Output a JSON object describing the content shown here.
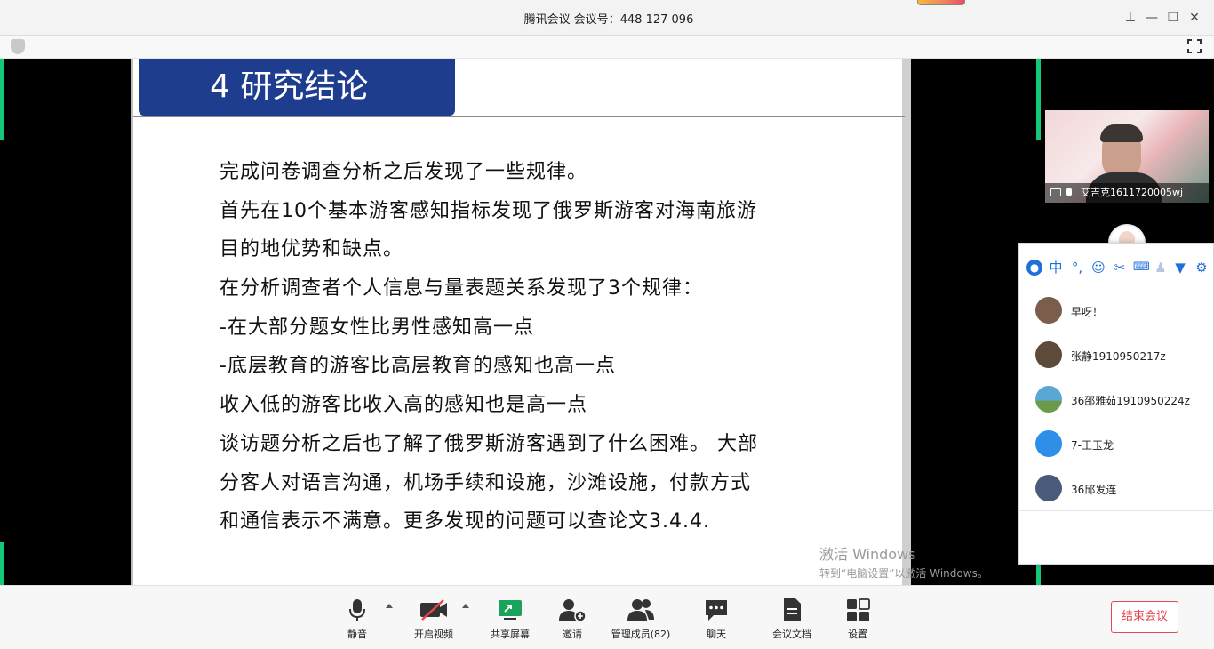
{
  "window": {
    "title_app": "腾讯会议",
    "title_meeting": "会议号：448 127 096"
  },
  "slide": {
    "title": "4  研究结论",
    "lines": [
      "完成问卷调查分析之后发现了一些规律。",
      "首先在10个基本游客感知指标发现了俄罗斯游客对海南旅游",
      "目的地优势和缺点。",
      "在分析调查者个人信息与量表题关系发现了3个规律：",
      "-在大部分题女性比男性感知高一点",
      "-底层教育的游客比高层教育的感知也高一点",
      "收入低的游客比收入高的感知也是高一点",
      "谈访题分析之后也了解了俄罗斯游客遇到了什么困难。 大部",
      "分客人对语言沟通，机场手续和设施，沙滩设施，付款方式",
      "和通信表示不满意。更多发现的问题可以查论文3.4.4."
    ]
  },
  "watermark": {
    "line1": "激活 Windows",
    "line2": "转到“电脑设置”以激活 Windows。"
  },
  "video_tile": {
    "name": "艾吉克1611720005wj"
  },
  "popup": {
    "toolbar_icons": [
      "user-icon",
      "chinese-input-icon",
      "punctuation-icon",
      "emoji-icon",
      "scissors-icon",
      "keyboard-icon",
      "person-icon",
      "shirt-icon",
      "settings-icon"
    ],
    "toolbar_glyphs": [
      "中"
    ],
    "messages": [
      {
        "name": "早呀！",
        "avatar_color": "#7a5d4a"
      },
      {
        "name": "张静1910950217z",
        "avatar_color": "#5c4a3a"
      },
      {
        "name": "36邵雅茹1910950224z",
        "avatar_color": "#5aa7d6"
      },
      {
        "name": "7-王玉龙",
        "avatar_color": "#2f8ee8"
      },
      {
        "name": "36邱发连",
        "avatar_color": "#4a5a7a"
      }
    ]
  },
  "toolbar": {
    "mute": "静音",
    "video": "开启视频",
    "share": "共享屏幕",
    "invite": "邀请",
    "members": "管理成员(82)",
    "chat": "聊天",
    "docs": "会议文档",
    "settings": "设置",
    "end": "结束会议"
  },
  "colors": {
    "slide_title_bg": "#1e3d8f",
    "accent_green": "#14c87a",
    "end_red": "#e5484d",
    "popup_icon_blue": "#1e6fd9"
  }
}
